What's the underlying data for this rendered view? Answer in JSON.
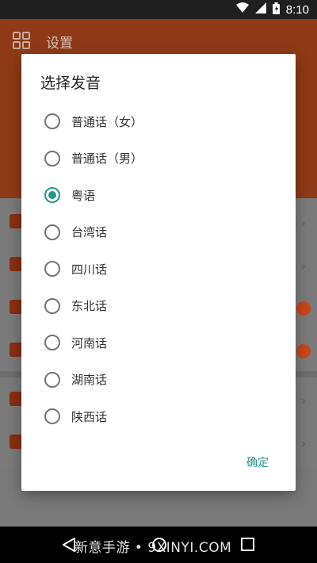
{
  "status_bar": {
    "time": "8:10",
    "icons": [
      "wifi-icon",
      "signal-icon",
      "battery-icon"
    ]
  },
  "app_bar": {
    "title": "设置",
    "icon": "grid-icon"
  },
  "dialog": {
    "title": "选择发音",
    "options": [
      {
        "label": "普通话（女）",
        "selected": false
      },
      {
        "label": "普通话（男）",
        "selected": false
      },
      {
        "label": "粤语",
        "selected": true
      },
      {
        "label": "台湾话",
        "selected": false
      },
      {
        "label": "四川话",
        "selected": false
      },
      {
        "label": "东北话",
        "selected": false
      },
      {
        "label": "河南话",
        "selected": false
      },
      {
        "label": "湖南话",
        "selected": false
      },
      {
        "label": "陕西话",
        "selected": false
      }
    ],
    "confirm_label": "确定"
  },
  "nav_bar": {
    "watermark": "新意手游 • 9XINYI.COM",
    "icons": [
      "back-icon",
      "home-icon",
      "recent-apps-icon"
    ]
  },
  "colors": {
    "accent": "#27958f",
    "app_bar": "#8e3a17",
    "toggle": "#c8471b"
  }
}
